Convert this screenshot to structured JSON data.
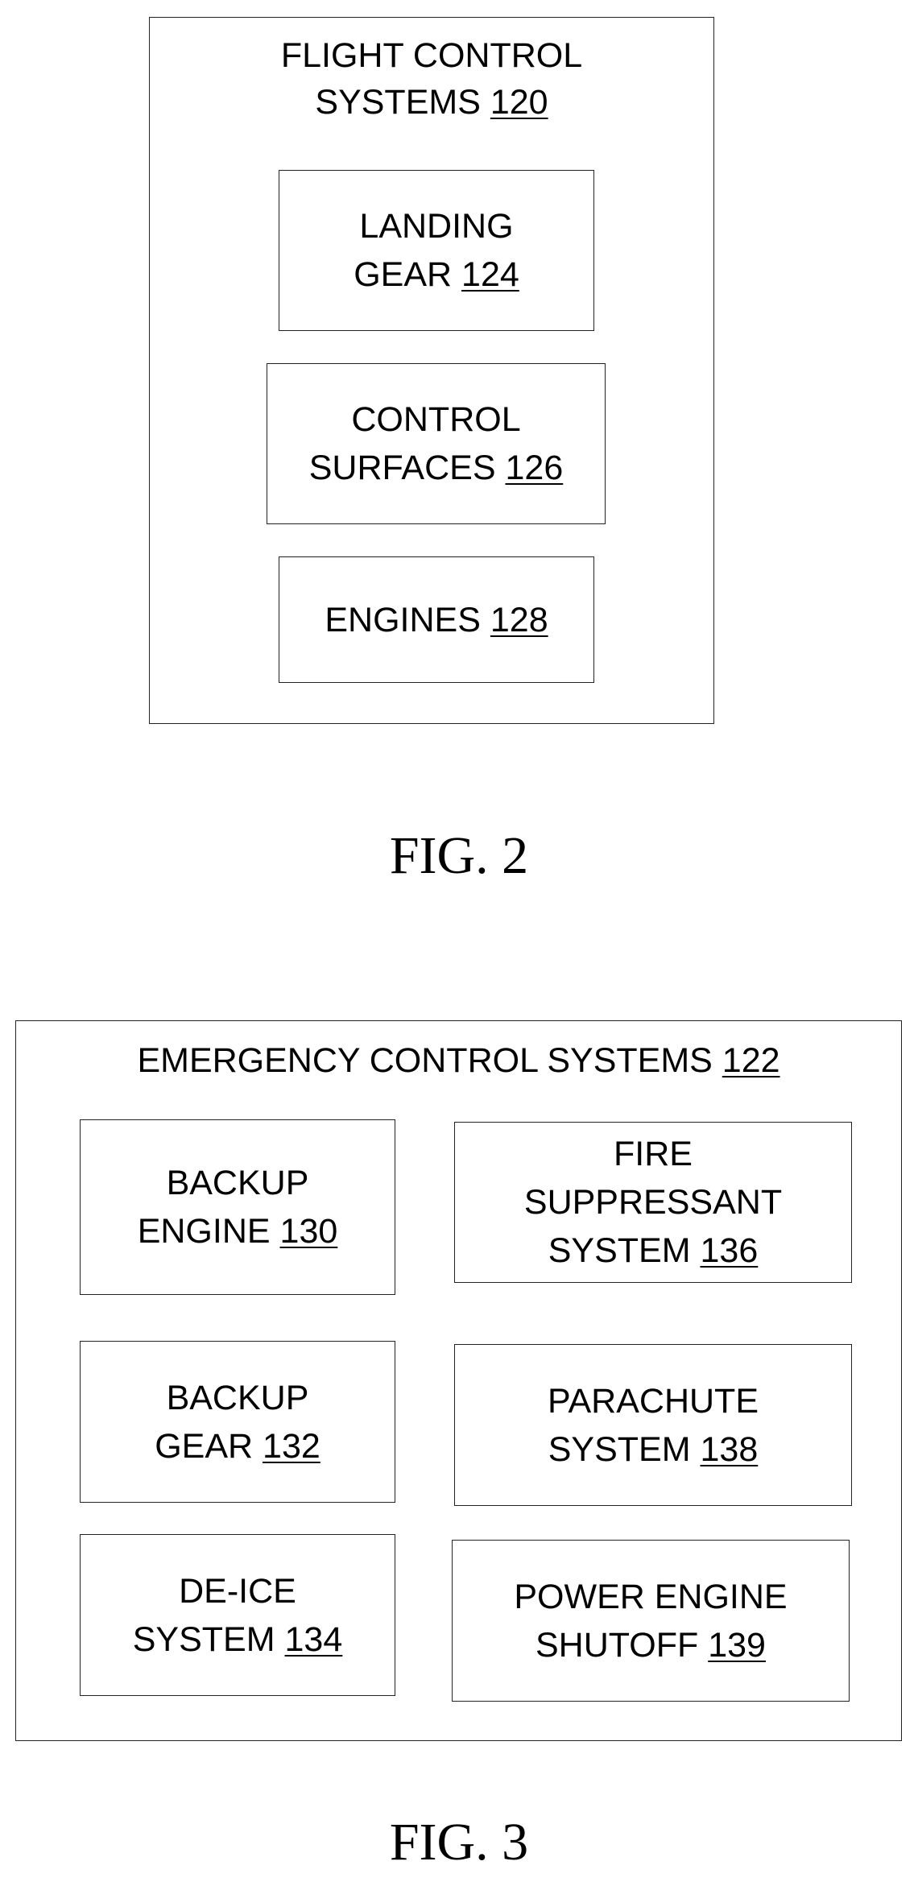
{
  "fig2": {
    "caption": "FIG. 2",
    "container": {
      "line1": "FLIGHT CONTROL",
      "line2": "SYSTEMS",
      "ref": "120"
    },
    "components": [
      {
        "line1": "LANDING",
        "line2": "GEAR",
        "ref": "124"
      },
      {
        "line1": "CONTROL",
        "line2": "SURFACES",
        "ref": "126"
      },
      {
        "line1": "",
        "line2": "ENGINES",
        "ref": "128"
      }
    ]
  },
  "fig3": {
    "caption": "FIG. 3",
    "container": {
      "title": "EMERGENCY CONTROL SYSTEMS",
      "ref": "122"
    },
    "components": [
      {
        "line1": "",
        "line2": "BACKUP",
        "line3": "ENGINE",
        "ref": "130"
      },
      {
        "line1": "FIRE",
        "line2": "SUPPRESSANT",
        "line3": "SYSTEM",
        "ref": "136"
      },
      {
        "line1": "",
        "line2": "BACKUP",
        "line3": "GEAR",
        "ref": "132"
      },
      {
        "line1": "",
        "line2": "PARACHUTE",
        "line3": "SYSTEM",
        "ref": "138"
      },
      {
        "line1": "",
        "line2": "DE-ICE",
        "line3": "SYSTEM",
        "ref": "134"
      },
      {
        "line1": "",
        "line2": "POWER ENGINE",
        "line3": "SHUTOFF",
        "ref": "139"
      }
    ]
  }
}
